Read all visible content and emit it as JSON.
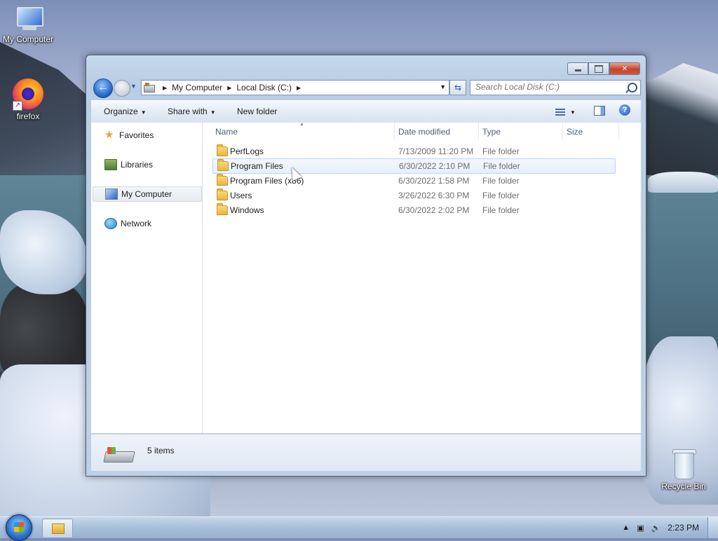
{
  "desktop": {
    "icons": [
      {
        "label": "My Computer",
        "icon": "computer-icon"
      },
      {
        "label": "firefox",
        "icon": "firefox-icon"
      },
      {
        "label": "Recycle Bin",
        "icon": "recycle-bin-icon"
      }
    ]
  },
  "window": {
    "address": {
      "crumbs": [
        "My Computer",
        "Local Disk (C:)"
      ]
    },
    "search": {
      "placeholder": "Search Local Disk (C:)"
    },
    "toolbar": {
      "organize": "Organize",
      "share_with": "Share with",
      "new_folder": "New folder"
    },
    "nav": {
      "favorites": "Favorites",
      "libraries": "Libraries",
      "my_computer": "My Computer",
      "network": "Network"
    },
    "columns": {
      "name": "Name",
      "date": "Date modified",
      "type": "Type",
      "size": "Size"
    },
    "files": [
      {
        "name": "PerfLogs",
        "date": "7/13/2009 11:20 PM",
        "type": "File folder"
      },
      {
        "name": "Program Files",
        "date": "6/30/2022 2:10 PM",
        "type": "File folder"
      },
      {
        "name": "Program Files (x86)",
        "date": "6/30/2022 1:58 PM",
        "type": "File folder"
      },
      {
        "name": "Users",
        "date": "3/26/2022 6:30 PM",
        "type": "File folder"
      },
      {
        "name": "Windows",
        "date": "6/30/2022 2:02 PM",
        "type": "File folder"
      }
    ],
    "details": {
      "items_count": "5 items"
    }
  },
  "taskbar": {
    "clock": "2:23 PM"
  },
  "colors": {
    "accent": "#2a6ec9",
    "hover_row_border": "#b8d6fb"
  }
}
